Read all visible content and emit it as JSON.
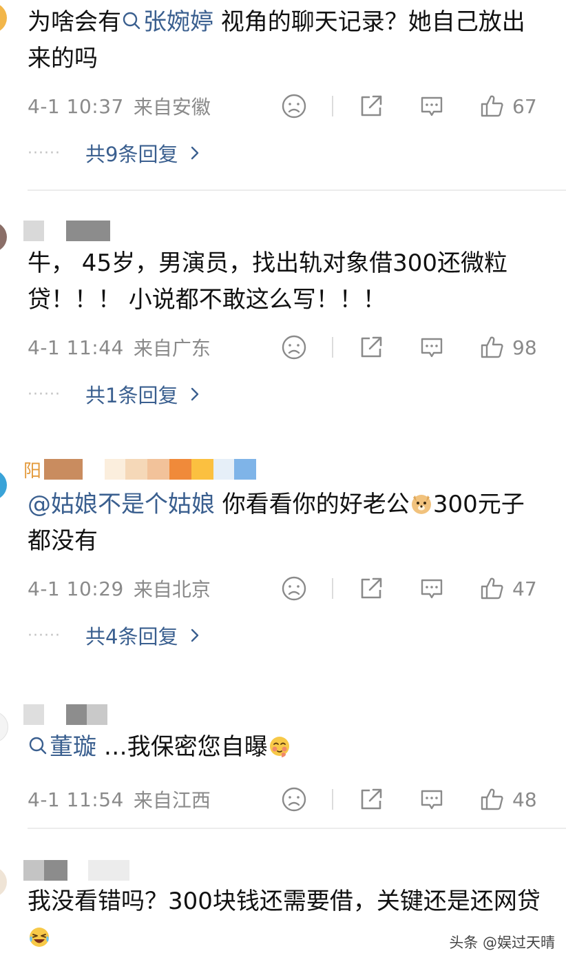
{
  "comments": [
    {
      "text_pre": "为啥会有",
      "mention": "张婉婷",
      "text_post": " 视角的聊天记录？她自己放出来的吗",
      "time": "4-1 10:37",
      "location": "来自安徽",
      "likes": "67",
      "replies": "共9条回复"
    },
    {
      "text": "牛， 45岁，男演员，找出轨对象借300还微粒贷！！！ 小说都不敢这么写！！！",
      "time": "4-1 11:44",
      "location": "来自广东",
      "likes": "98",
      "replies": "共1条回复"
    },
    {
      "username_visible": "阳",
      "mention": "@姑娘不是个姑娘",
      "text_mid": " 你看看你的好老公",
      "text_post": "300元子都没有",
      "time": "4-1 10:29",
      "location": "来自北京",
      "likes": "47",
      "replies": "共4条回复"
    },
    {
      "mention": "董璇",
      "text_post": " …我保密您自曝",
      "time": "4-1 11:54",
      "location": "来自江西",
      "likes": "48"
    },
    {
      "text": "我没看错吗？300块钱还需要借，关键还是还网贷"
    }
  ],
  "watermark": "头条 @娱过天晴",
  "colors": {
    "link": "#3a5f8f",
    "meta": "#8a8a8a",
    "divider": "#ececec"
  }
}
